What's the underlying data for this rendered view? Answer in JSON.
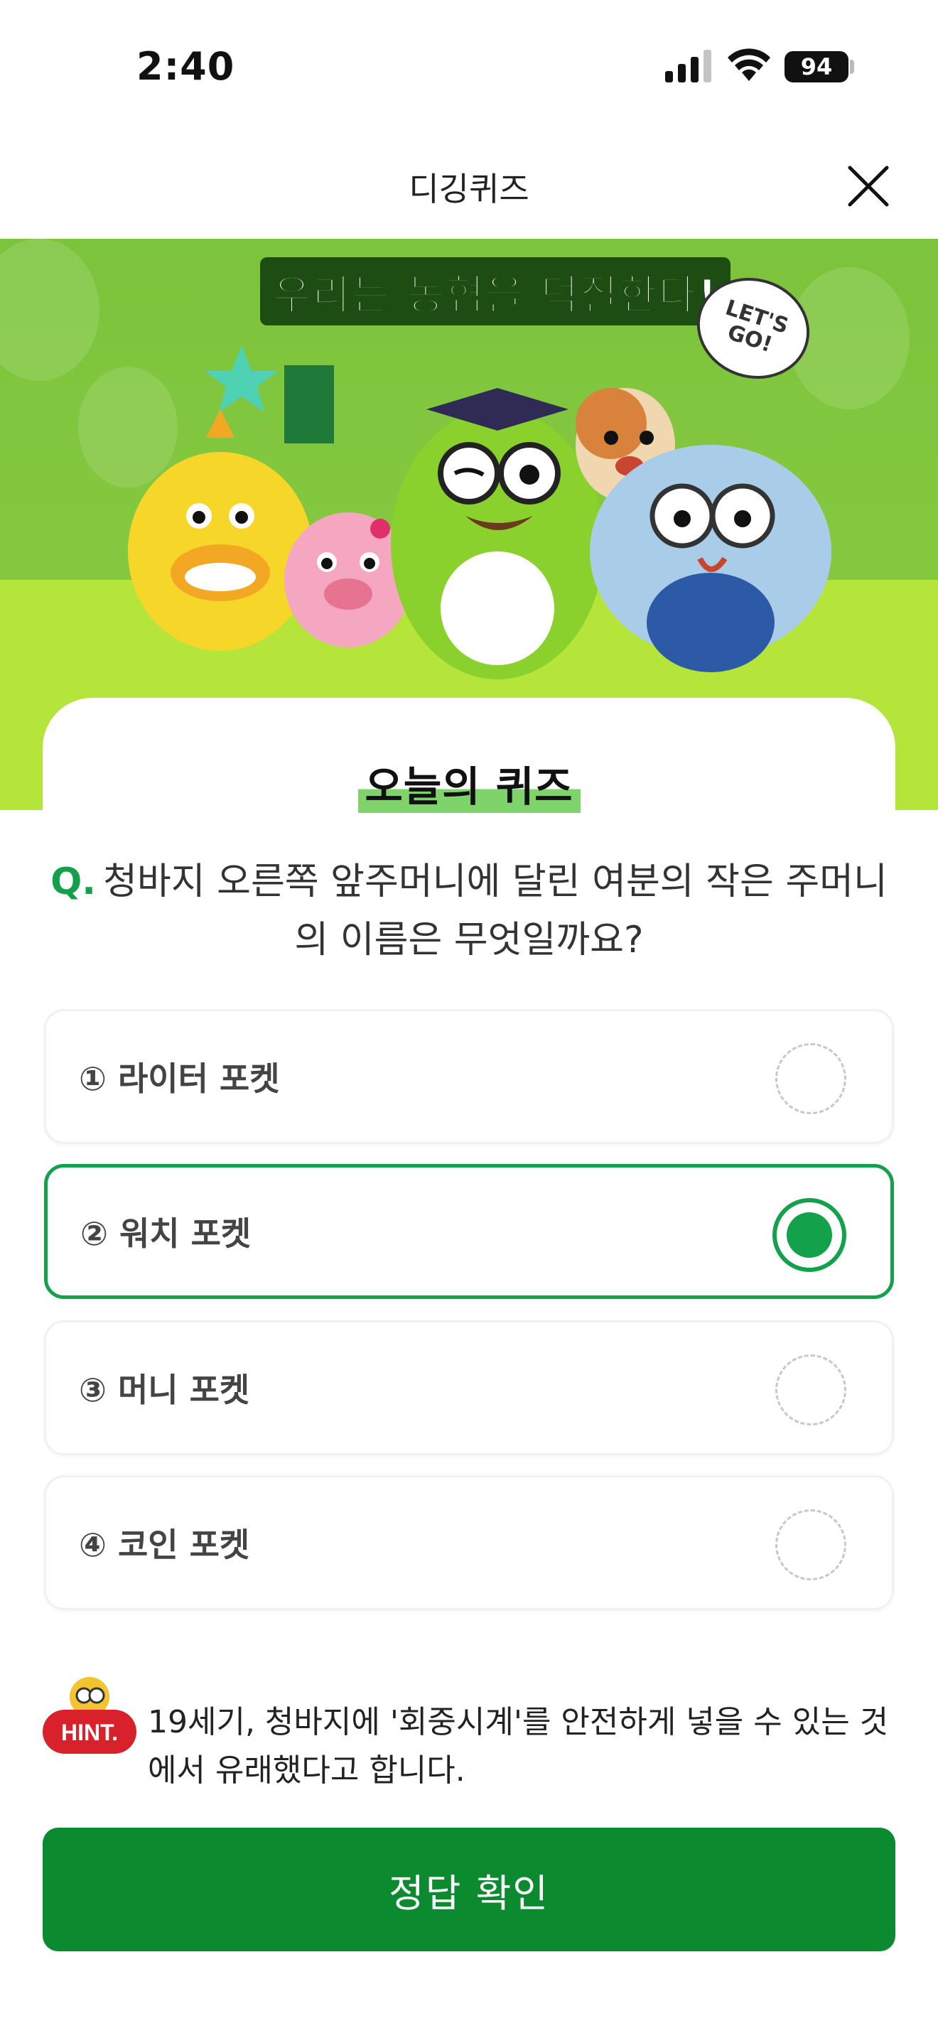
{
  "status_bar": {
    "time": "2:40",
    "battery": "94"
  },
  "header": {
    "title": "디깅퀴즈"
  },
  "banner": {
    "headline": "우리는 농협을 덕질한다!",
    "speech_bubble": "LET'S GO!"
  },
  "card": {
    "title": "오늘의 퀴즈"
  },
  "question": {
    "prefix": "Q.",
    "text": "청바지 오른쪽 앞주머니에 달린 여분의 작은 주머니의 이름은 무엇일까요?"
  },
  "options": [
    {
      "label": "① 라이터 포켓",
      "selected": false
    },
    {
      "label": "② 워치 포켓",
      "selected": true
    },
    {
      "label": "③ 머니 포켓",
      "selected": false
    },
    {
      "label": "④ 코인 포켓",
      "selected": false
    }
  ],
  "hint": {
    "badge": "HINT.",
    "text": "19세기, 청바지에 '회중시계'를 안전하게 넣을 수 있는 것에서 유래했다고 합니다."
  },
  "confirm_button": {
    "label": "정답 확인"
  },
  "colors": {
    "accent": "#13a14b",
    "button": "#0b8a2f",
    "hint_red": "#d8212a"
  }
}
